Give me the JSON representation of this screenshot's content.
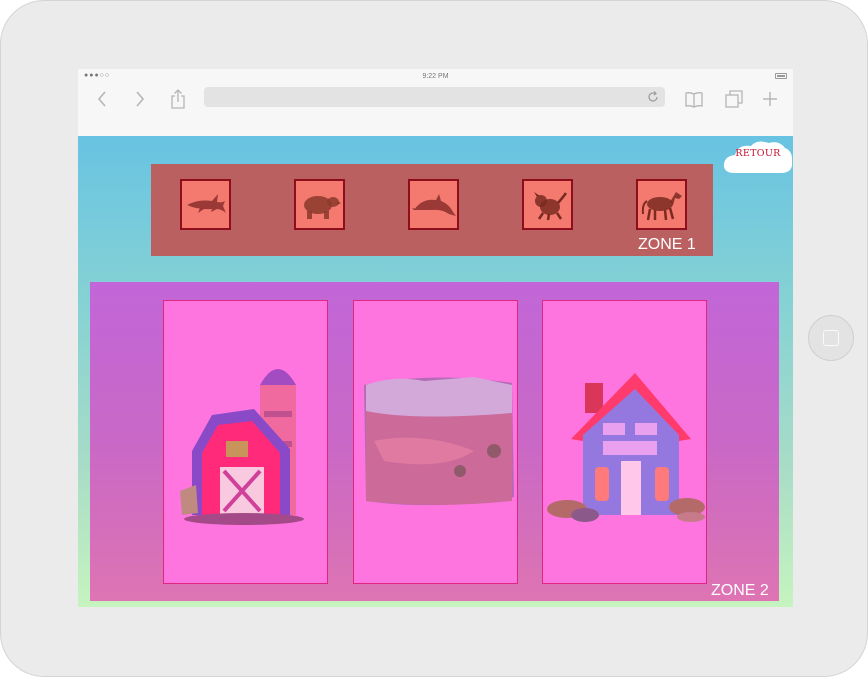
{
  "browser": {
    "status_time": "9:22 PM",
    "signal_dots": "●●●○○"
  },
  "page": {
    "back_button_label": "RETOUR",
    "zone1": {
      "label": "ZONE 1",
      "animals": [
        {
          "name": "shark",
          "icon": "shark-icon"
        },
        {
          "name": "bear",
          "icon": "bear-icon"
        },
        {
          "name": "dolphin",
          "icon": "dolphin-icon"
        },
        {
          "name": "dog",
          "icon": "dog-icon"
        },
        {
          "name": "horse",
          "icon": "horse-icon"
        }
      ]
    },
    "zone2": {
      "label": "ZONE 2",
      "targets": [
        {
          "name": "farm",
          "icon": "barn-icon"
        },
        {
          "name": "wild-landscape",
          "icon": "landscape-icon"
        },
        {
          "name": "house",
          "icon": "house-icon"
        }
      ]
    }
  },
  "colors": {
    "zone1_bg": "#bb6060",
    "animal_tile": "#f47a70",
    "animal_border": "#8e0f1b",
    "zone2_bg": "#c968c6",
    "dropbox_bg": "#ff75e0",
    "dropbox_border": "#e0267e",
    "retour_text": "#c8102e"
  }
}
